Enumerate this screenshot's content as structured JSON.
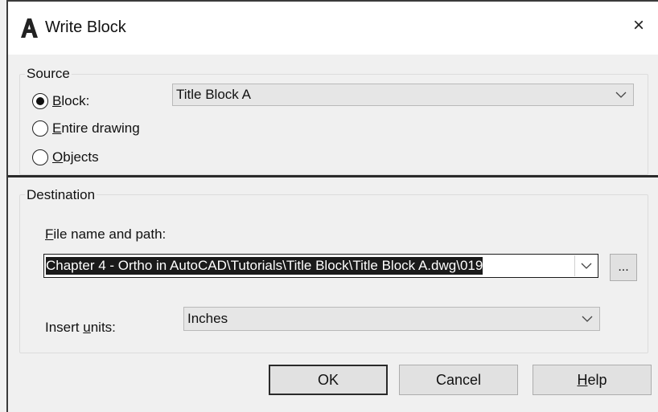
{
  "window": {
    "title": "Write Block",
    "close_glyph": "×",
    "app_icon": "autocad-a-icon"
  },
  "source": {
    "group_label": "Source",
    "radios": [
      {
        "pre": "",
        "mnemonic": "B",
        "post": "lock:",
        "selected": true
      },
      {
        "pre": "",
        "mnemonic": "E",
        "post": "ntire drawing",
        "selected": false
      },
      {
        "pre": "",
        "mnemonic": "O",
        "post": "bjects",
        "selected": false
      }
    ],
    "block_combo_value": "Title Block A"
  },
  "destination": {
    "group_label": "Destination",
    "file_label_mnemonic": "F",
    "file_label_rest": "ile name and path:",
    "file_path_value": "019\\Chapter 4 - Ortho in AutoCAD\\Tutorials\\Title Block\\Title Block A.dwg",
    "browse_label": "...",
    "insert_units_pre": "Insert ",
    "insert_units_mnemonic": "u",
    "insert_units_post": "nits:",
    "insert_units_value": "Inches"
  },
  "buttons": {
    "ok": "OK",
    "cancel": "Cancel",
    "help_mnemonic": "H",
    "help_rest": "elp"
  }
}
